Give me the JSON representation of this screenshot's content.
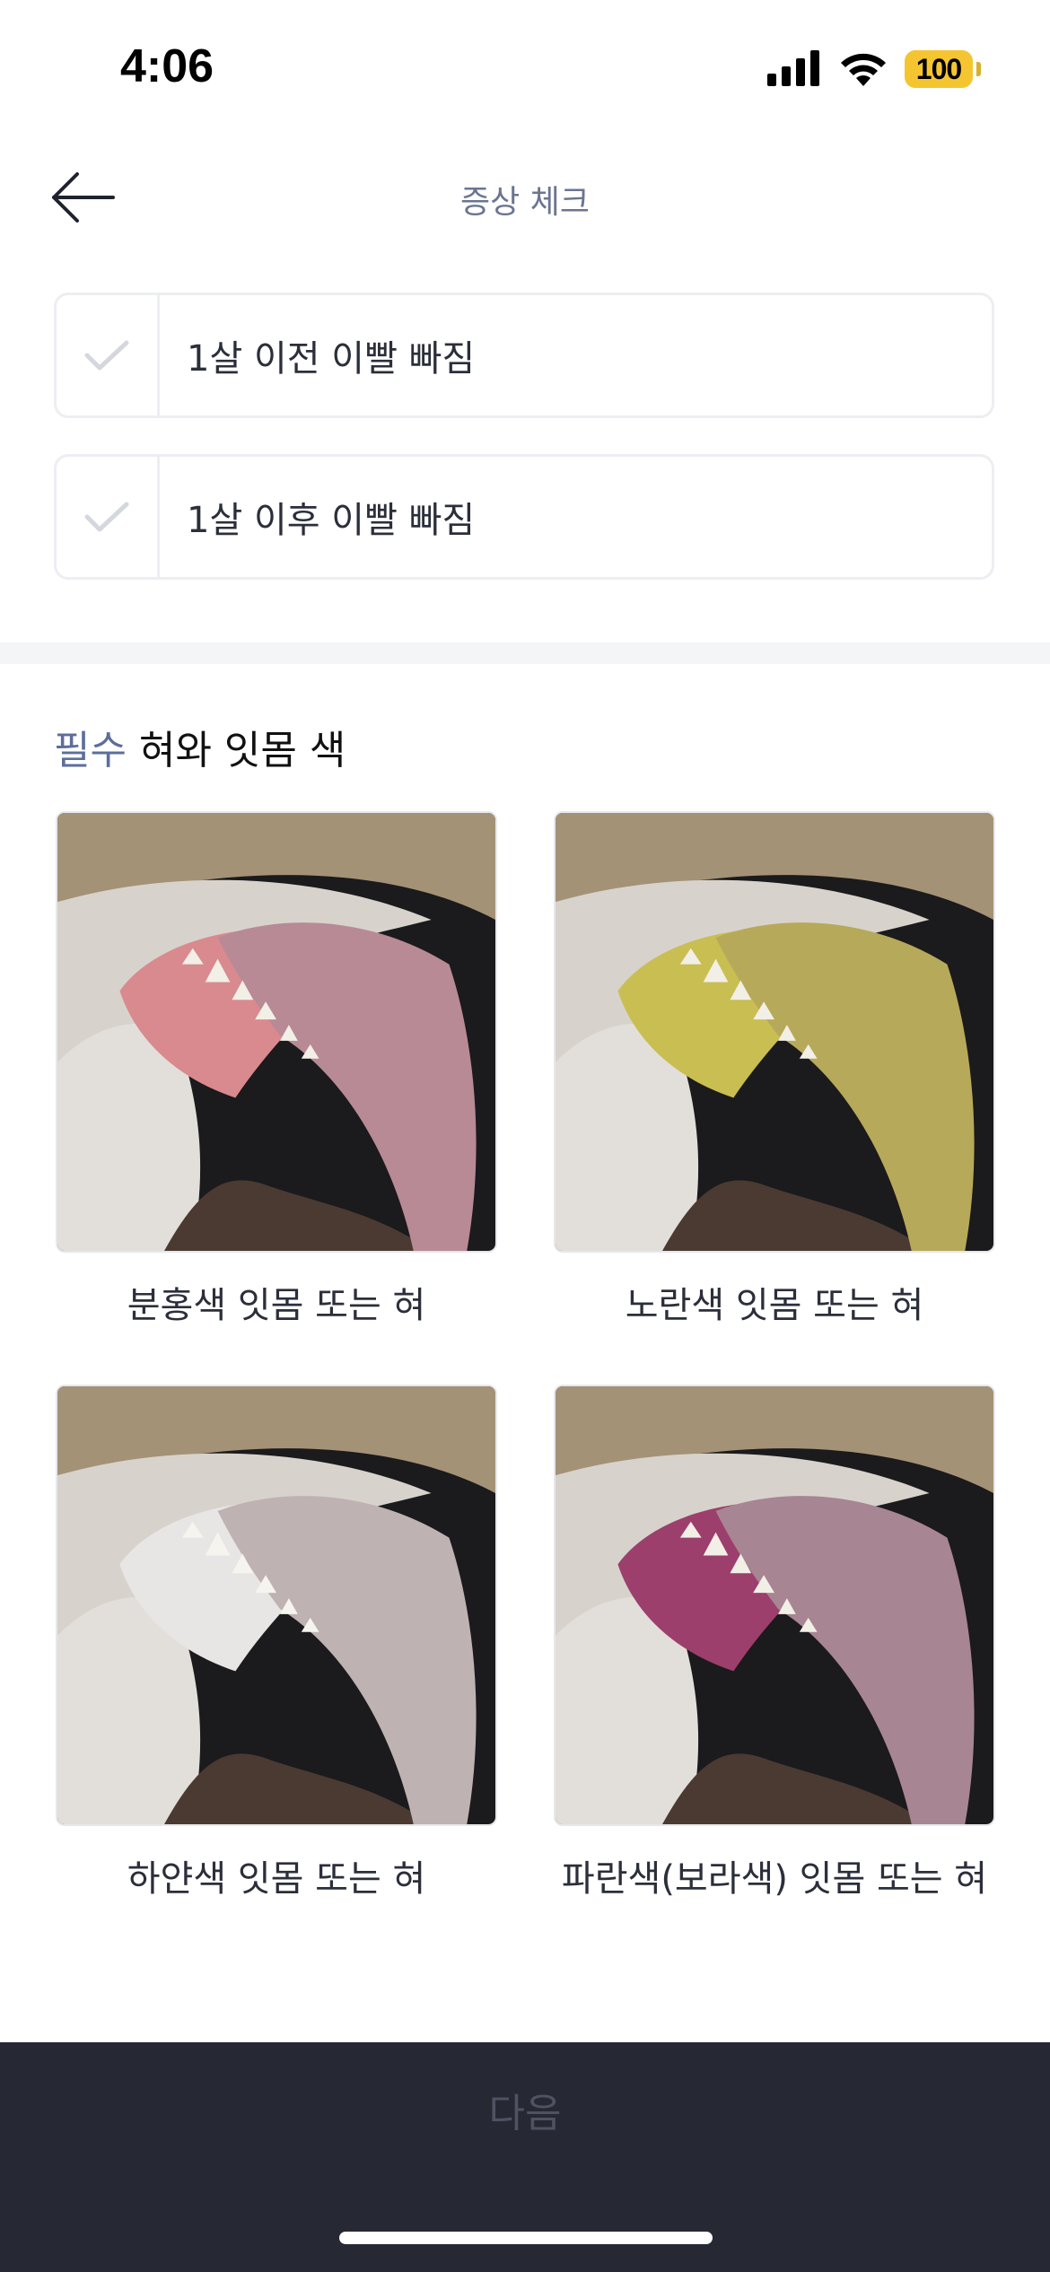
{
  "status_bar": {
    "time": "4:06",
    "battery": "100",
    "signal_icon": "cellular-signal-icon",
    "wifi_icon": "wifi-icon",
    "battery_color": "#f5c531"
  },
  "header": {
    "title": "증상 체크",
    "back_icon": "arrow-left-icon"
  },
  "symptoms": [
    {
      "label": "1살 이전 이빨 빠짐",
      "checked": false
    },
    {
      "label": "1살 이후 이빨 빠짐",
      "checked": false
    }
  ],
  "section": {
    "required": "필수",
    "title": "혀와 잇몸 색"
  },
  "options": [
    {
      "label": "분홍색 잇몸 또는 혀",
      "tint": "#d98a8e"
    },
    {
      "label": "노란색 잇몸 또는 혀",
      "tint": "#c9be52"
    },
    {
      "label": "하얀색 잇몸 또는 혀",
      "tint": "#e8e6e4"
    },
    {
      "label": "파란색(보라색) 잇몸 또는 혀",
      "tint": "#9c3f6c"
    }
  ],
  "footer": {
    "next_label": "다음",
    "bar_color": "#262833"
  }
}
